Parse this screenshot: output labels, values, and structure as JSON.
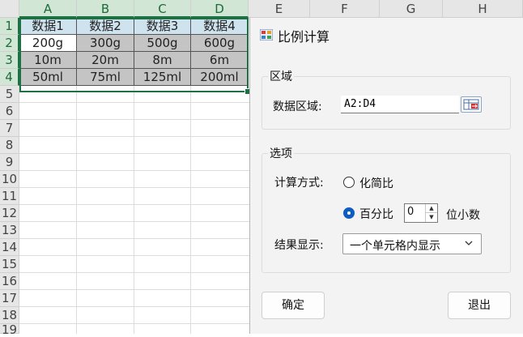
{
  "spreadsheet": {
    "columns": [
      "A",
      "B",
      "C",
      "D",
      "E",
      "F",
      "G",
      "H"
    ],
    "rows": [
      "1",
      "2",
      "3",
      "4",
      "5",
      "6",
      "7",
      "8",
      "9",
      "10",
      "11",
      "12",
      "13",
      "14",
      "15",
      "16",
      "17",
      "18",
      "19"
    ],
    "cells": [
      [
        "数据1",
        "数据2",
        "数据3",
        "数据4"
      ],
      [
        "200g",
        "300g",
        "500g",
        "600g"
      ],
      [
        "10m",
        "20m",
        "8m",
        "6m"
      ],
      [
        "50ml",
        "75ml",
        "125ml",
        "200ml"
      ]
    ]
  },
  "dialog": {
    "title": "比例计算",
    "region_group": "区域",
    "data_range_label": "数据区域:",
    "data_range_value": "A2:D4",
    "options_group": "选项",
    "calc_method_label": "计算方式:",
    "option_simplify": "化简比",
    "option_percent": "百分比",
    "decimals_value": "0",
    "decimals_suffix": "位小数",
    "result_label": "结果显示:",
    "result_value": "一个单元格内显示",
    "ok_button": "确定",
    "exit_button": "退出"
  }
}
